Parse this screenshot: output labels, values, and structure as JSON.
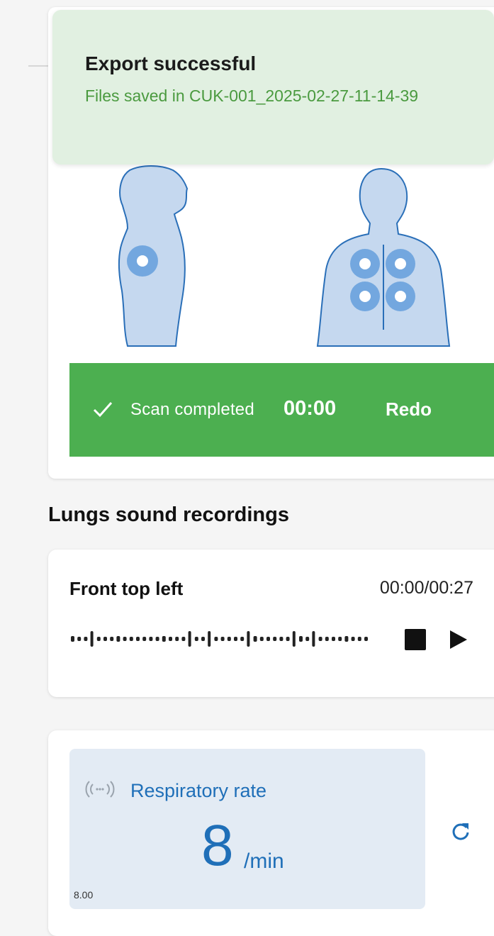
{
  "toast": {
    "title": "Export successful",
    "message": "Files saved in CUK-001_2025-02-27-11-14-39"
  },
  "scan": {
    "status_label": "Scan completed",
    "time": "00:00",
    "redo_label": "Redo",
    "status_color": "#4caf50"
  },
  "section": {
    "title": "Lungs sound recordings"
  },
  "recording": {
    "title": "Front top left",
    "time": "00:00/00:27",
    "icons": [
      "waveform-icon",
      "stop-icon",
      "play-icon"
    ]
  },
  "respiratory": {
    "label": "Respiratory rate",
    "value": "8",
    "unit": "/min",
    "raw_value": "8.00",
    "accent_color": "#1f6fb8",
    "icons": [
      "signal-icon",
      "refresh-icon"
    ]
  }
}
